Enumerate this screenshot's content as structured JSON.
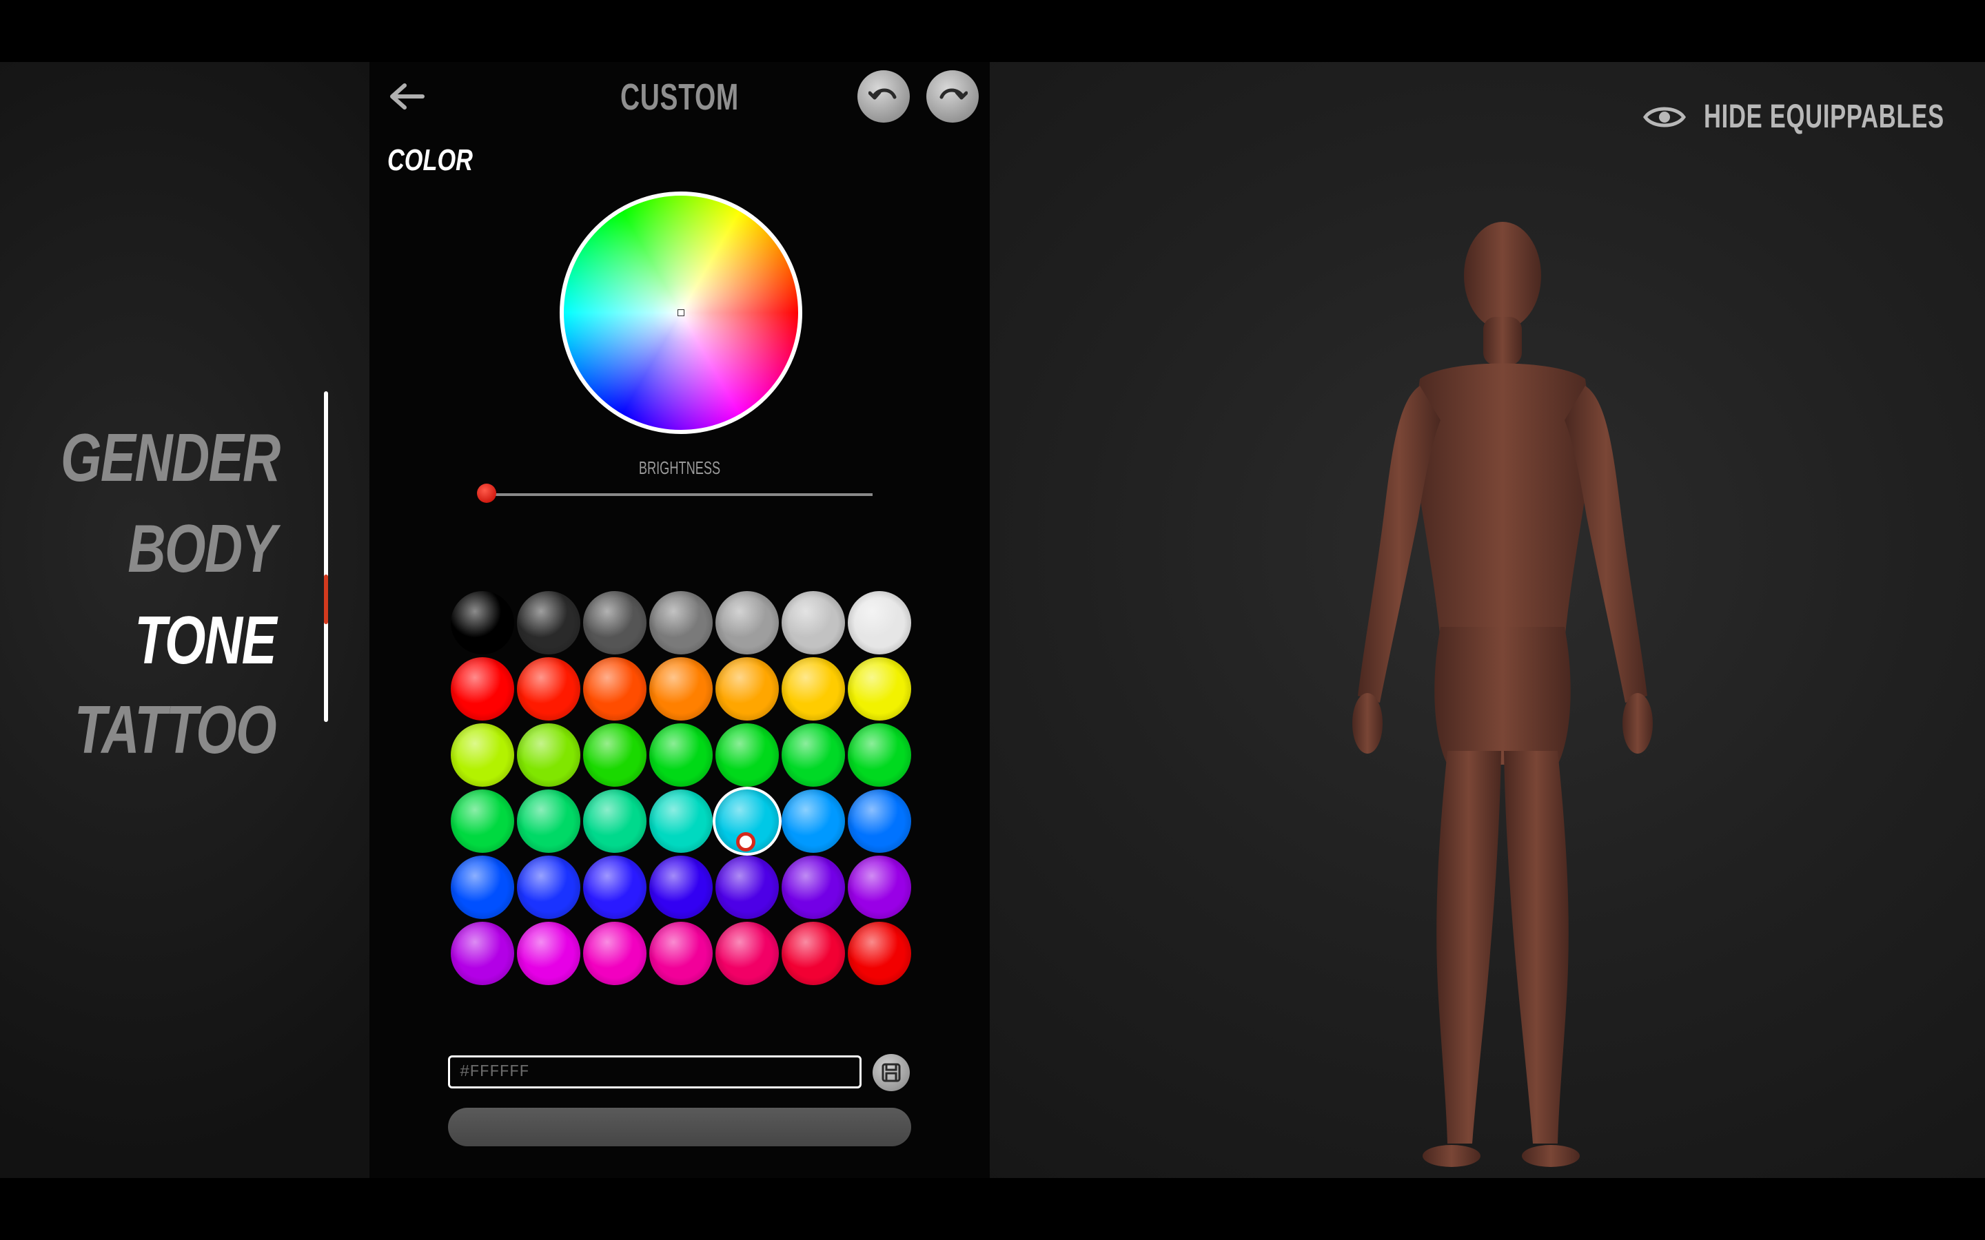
{
  "nav": {
    "items": [
      {
        "label": "GENDER",
        "active": false
      },
      {
        "label": "BODY",
        "active": false
      },
      {
        "label": "TONE",
        "active": true
      },
      {
        "label": "TATTOO",
        "active": false
      }
    ]
  },
  "panel": {
    "title": "CUSTOM",
    "section_label": "COLOR",
    "brightness_label": "BRIGHTNESS",
    "brightness_value": 0,
    "hex_placeholder": "#FFFFFF",
    "selected_swatch_row": 3,
    "selected_swatch_col": 4
  },
  "swatches": [
    [
      "#000000",
      "#2a2a2a",
      "#555555",
      "#7a7a7a",
      "#9e9e9e",
      "#c2c2c2",
      "#e6e6e6"
    ],
    [
      "#ff0000",
      "#ff1a00",
      "#ff4d00",
      "#ff8000",
      "#ffa600",
      "#ffcc00",
      "#f2f200"
    ],
    [
      "#b3f200",
      "#80e600",
      "#1ad900",
      "#00d916",
      "#00d91a",
      "#00d926",
      "#00d91f"
    ],
    [
      "#00d940",
      "#00d966",
      "#00d98c",
      "#00d9c0",
      "#00c8e6",
      "#0099ff",
      "#0073ff"
    ],
    [
      "#0050ff",
      "#1a33ff",
      "#2a1aff",
      "#3300f2",
      "#4d00e6",
      "#7300e6",
      "#9900e6"
    ],
    [
      "#b300e6",
      "#e600e6",
      "#f200c0",
      "#f20099",
      "#f20066",
      "#f20033",
      "#f20000"
    ]
  ],
  "right": {
    "hide_label": "HIDE EQUIPPABLES",
    "skin_color": "#6a3a2e"
  }
}
